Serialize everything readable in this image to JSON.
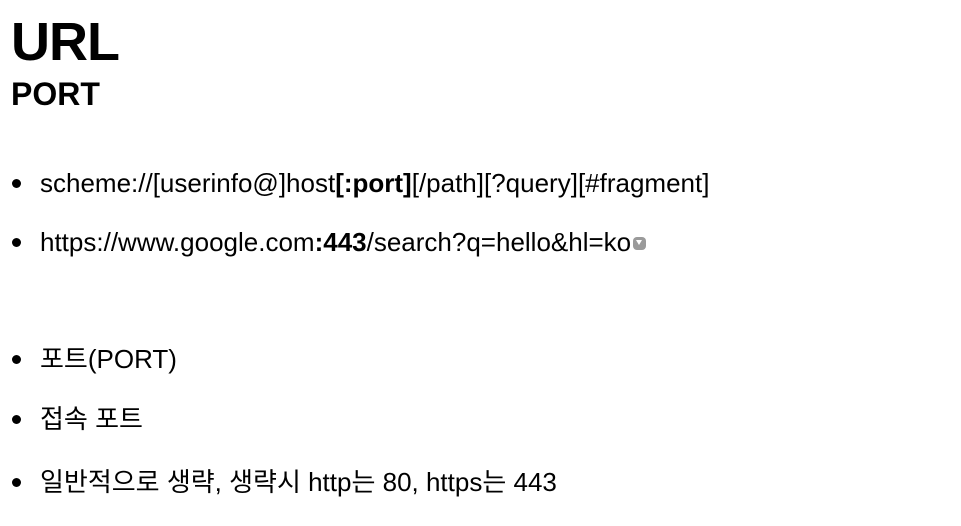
{
  "title": "URL",
  "subtitle": "PORT",
  "bullets": {
    "syntax": {
      "before": "scheme://[userinfo@]host",
      "emphasis": "[:port]",
      "after": "[/path][?query][#fragment]"
    },
    "example": {
      "before": "https://www.google.com",
      "emphasis": ":443",
      "after": "/search?q=hello&hl=ko",
      "icon": "chevron-down-icon"
    },
    "port": "포트(PORT)",
    "connection_port": "접속 포트",
    "default_note": "일반적으로 생략, 생략시 http는 80, https는 443"
  }
}
